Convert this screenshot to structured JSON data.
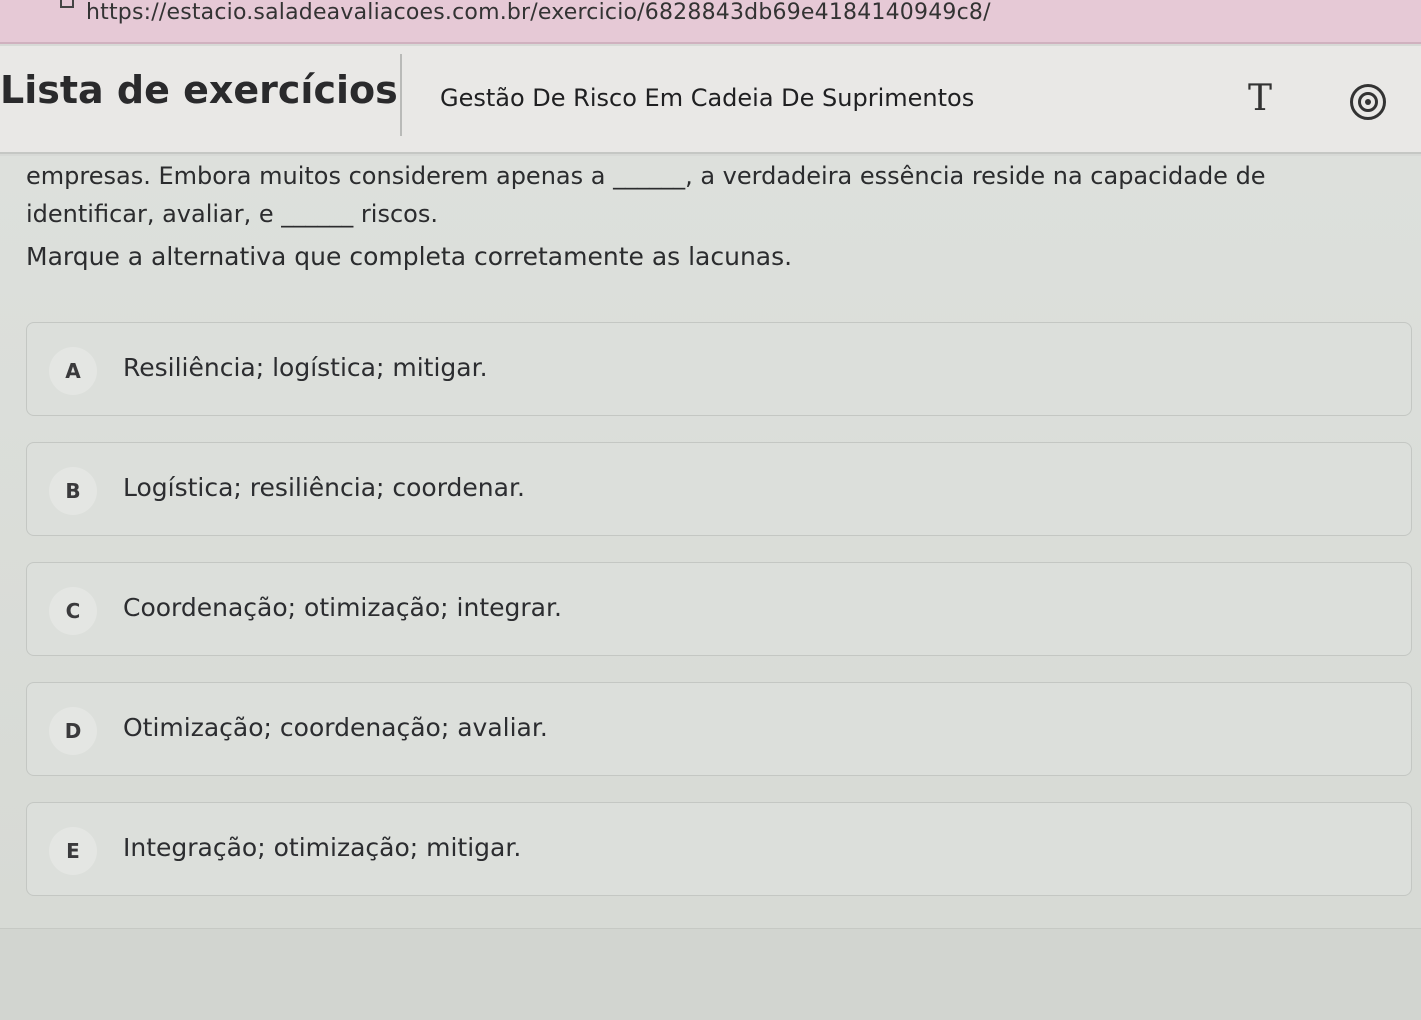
{
  "browser": {
    "url": "https://estacio.saladeavaliacoes.com.br/exercicio/6828843db69e4184140949c8/"
  },
  "header": {
    "brand_title": "Lista de exercícios",
    "course_title": "Gestão De Risco Em Cadeia De Suprimentos",
    "font_size_button_label": "T"
  },
  "question": {
    "line1": "empresas. Embora muitos considerem apenas a ______, a verdadeira essência reside na capacidade de",
    "line2": "identificar, avaliar, e ______ riscos.",
    "instruction": "Marque a alternativa que completa corretamente as lacunas."
  },
  "options": [
    {
      "letter": "A",
      "text": "Resiliência; logística; mitigar."
    },
    {
      "letter": "B",
      "text": "Logística; resiliência; coordenar."
    },
    {
      "letter": "C",
      "text": "Coordenação; otimização; integrar."
    },
    {
      "letter": "D",
      "text": "Otimização; coordenação; avaliar."
    },
    {
      "letter": "E",
      "text": "Integração; otimização; mitigar."
    }
  ]
}
